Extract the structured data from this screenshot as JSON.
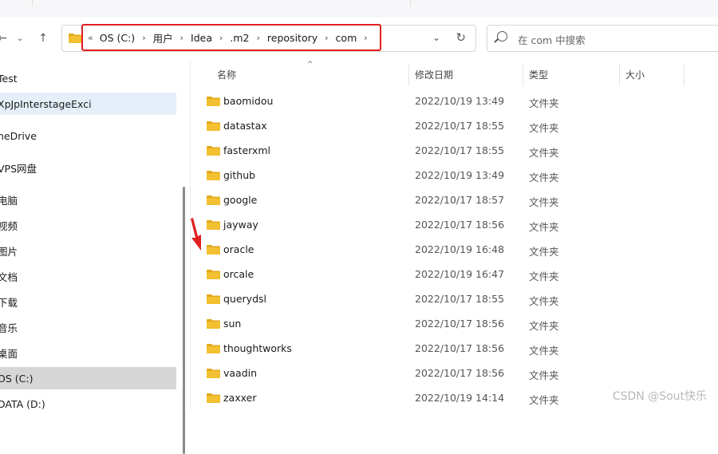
{
  "address": {
    "lead": "«",
    "crumbs": [
      "OS (C:)",
      "用户",
      "Idea",
      ".m2",
      "repository",
      "com"
    ]
  },
  "search": {
    "placeholder": "在 com 中搜索"
  },
  "columns": {
    "name": "名称",
    "modified": "修改日期",
    "type": "类型",
    "size": "大小"
  },
  "sidebar": {
    "items": [
      {
        "label": "Test"
      },
      {
        "label": "XpJpInterstageExci"
      },
      {
        "label": "neDrive"
      },
      {
        "label": "VPS网盘"
      },
      {
        "label": "电脑"
      },
      {
        "label": "视频"
      },
      {
        "label": "图片"
      },
      {
        "label": "文档"
      },
      {
        "label": "下载"
      },
      {
        "label": "音乐"
      },
      {
        "label": "桌面"
      },
      {
        "label": "OS (C:)"
      },
      {
        "label": "DATA (D:)"
      }
    ]
  },
  "files": [
    {
      "name": "baomidou",
      "date": "2022/10/19 13:49",
      "type": "文件夹"
    },
    {
      "name": "datastax",
      "date": "2022/10/17 18:55",
      "type": "文件夹"
    },
    {
      "name": "fasterxml",
      "date": "2022/10/17 18:55",
      "type": "文件夹"
    },
    {
      "name": "github",
      "date": "2022/10/19 13:49",
      "type": "文件夹"
    },
    {
      "name": "google",
      "date": "2022/10/17 18:57",
      "type": "文件夹"
    },
    {
      "name": "jayway",
      "date": "2022/10/17 18:56",
      "type": "文件夹"
    },
    {
      "name": "oracle",
      "date": "2022/10/19 16:48",
      "type": "文件夹"
    },
    {
      "name": "orcale",
      "date": "2022/10/19 16:47",
      "type": "文件夹"
    },
    {
      "name": "querydsl",
      "date": "2022/10/17 18:55",
      "type": "文件夹"
    },
    {
      "name": "sun",
      "date": "2022/10/17 18:56",
      "type": "文件夹"
    },
    {
      "name": "thoughtworks",
      "date": "2022/10/17 18:56",
      "type": "文件夹"
    },
    {
      "name": "vaadin",
      "date": "2022/10/17 18:56",
      "type": "文件夹"
    },
    {
      "name": "zaxxer",
      "date": "2022/10/19 14:14",
      "type": "文件夹"
    }
  ],
  "watermark": "CSDN @Sout快乐",
  "colors": {
    "folder": "#f2c030",
    "folderBack": "#e3a81c",
    "highlight": "#e02020",
    "selection": "#d6d6d6"
  },
  "icons": [
    "back-arrow-icon",
    "forward-arrow-icon",
    "recent-dropdown-icon",
    "up-arrow-icon",
    "folder-icon",
    "chevron-down-icon",
    "refresh-icon",
    "search-icon"
  ]
}
